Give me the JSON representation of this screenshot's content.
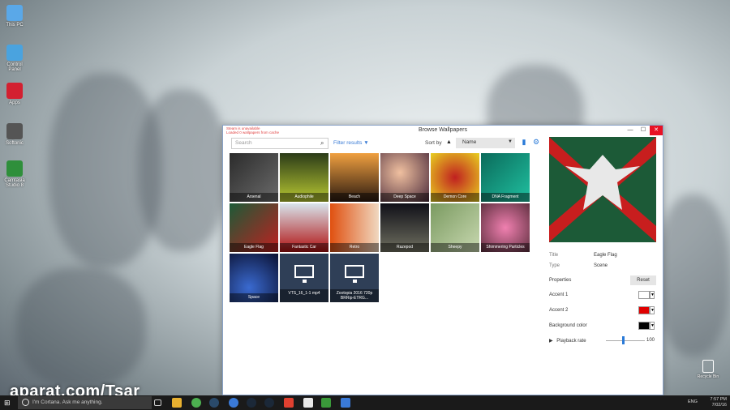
{
  "desktop": {
    "icons": [
      {
        "label": "This PC",
        "color": "#5aa8e8"
      },
      {
        "label": "Control Panel",
        "color": "#4aa3df"
      },
      {
        "label": "Apps",
        "color": "#d32030"
      },
      {
        "label": "Softonic",
        "color": "#555555"
      },
      {
        "label": "Camtasia Studio 8",
        "color": "#2f8f3b"
      }
    ],
    "recycle_bin": "Recycle Bin",
    "watermark": "aparat.com/Tsar"
  },
  "window": {
    "title": "Browse Wallpapers",
    "warning_line1": "Steam is unavailable",
    "warning_line2": "Loaded 0 wallpapers from cache",
    "controls": {
      "minimize": "—",
      "maximize": "☐",
      "close": "✕"
    },
    "search": {
      "placeholder": "Search",
      "value": ""
    },
    "filter_label": "Filter results",
    "sort_label": "Sort by",
    "sort_value": "Name",
    "tiles": [
      {
        "label": "Arsenal",
        "bg": "linear-gradient(135deg,#2b2b2b,#6b6b6b)"
      },
      {
        "label": "Audiophile",
        "bg": "linear-gradient(180deg,#2b3b18,#b8c832)"
      },
      {
        "label": "Beach",
        "bg": "linear-gradient(180deg,#f0a040,#2b1a10)"
      },
      {
        "label": "Deep Space",
        "bg": "radial-gradient(circle at 40% 40%,#f0c0a0,#4a2a3a)"
      },
      {
        "label": "Demon Core",
        "bg": "radial-gradient(circle,#c02020,#e8d020)"
      },
      {
        "label": "DNA Fragment",
        "bg": "linear-gradient(135deg,#0a6a5a,#20c0a0)"
      },
      {
        "label": "Eagle Flag",
        "bg": "linear-gradient(135deg,#1c5a37,#c02020)"
      },
      {
        "label": "Fantastic Car",
        "bg": "linear-gradient(180deg,#d8e4ec,#b01010)"
      },
      {
        "label": "Retro",
        "bg": "linear-gradient(90deg,#e05010,#f0d8c0)"
      },
      {
        "label": "Razepod",
        "bg": "linear-gradient(180deg,#101018,#707060)"
      },
      {
        "label": "Sheepy",
        "bg": "linear-gradient(135deg,#7a9a60,#c8d8b0)"
      },
      {
        "label": "Shimmering Particles",
        "bg": "radial-gradient(circle,#f080b0,#603040)"
      },
      {
        "label": "Space",
        "bg": "radial-gradient(circle at 40% 70%,#3a6ad0,#0a1030)"
      },
      {
        "label": "VTS_16_1-1 mp4",
        "bg": "#2f3f57"
      },
      {
        "label": "Zootopia 2016 720p BRRip-ETRG...",
        "bg": "#2f3f57"
      }
    ],
    "details": {
      "title_label": "Title",
      "title_value": "Eagle Flag",
      "type_label": "Type",
      "type_value": "Scene",
      "properties_label": "Properties",
      "reset_label": "Reset",
      "accent1_label": "Accent 1",
      "accent1_color": "#ffffff",
      "accent2_label": "Accent 2",
      "accent2_color": "#e00000",
      "background_label": "Background color",
      "background_color": "#000000",
      "playback_label": "Playback rate",
      "playback_value": "100"
    }
  },
  "taskbar": {
    "search_placeholder": "I'm Cortana. Ask me anything.",
    "lang": "ENG",
    "time": "7:57 PM",
    "date": "7/02/16"
  }
}
